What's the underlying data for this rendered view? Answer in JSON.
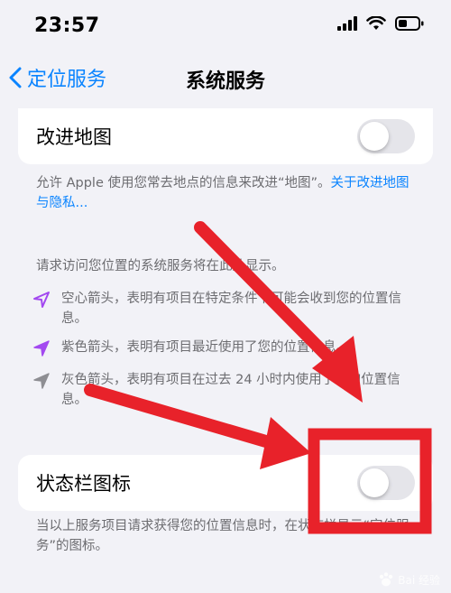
{
  "status_bar": {
    "time": "23:57"
  },
  "nav": {
    "back_label": "定位服务",
    "title": "系统服务"
  },
  "improve_maps": {
    "label": "改进地图",
    "toggle_on": false,
    "footnote": "允许 Apple 使用您常去地点的信息来改进“地图”。",
    "footnote_link": "关于改进地图与隐私..."
  },
  "legend": {
    "intro": "请求访问您位置的系统服务将在此处显示。",
    "items": [
      {
        "icon": "hollow-arrow-icon",
        "text": "空心箭头，表明有项目在特定条件下可能会收到您的位置信息。"
      },
      {
        "icon": "purple-arrow-icon",
        "text": "紫色箭头，表明有项目最近使用了您的位置信息。"
      },
      {
        "icon": "gray-arrow-icon",
        "text": "灰色箭头，表明有项目在过去 24 小时内使用了您的位置信息。"
      }
    ]
  },
  "status_bar_icon": {
    "label": "状态栏图标",
    "toggle_on": false,
    "footnote": "当以上服务项目请求获得您的位置信息时，在状态栏显示“定位服务”的图标。"
  },
  "watermark": {
    "text": "Bai 经验"
  },
  "colors": {
    "accent": "#0a84ff",
    "purple": "#a349f0",
    "annotation": "#e8222a"
  }
}
